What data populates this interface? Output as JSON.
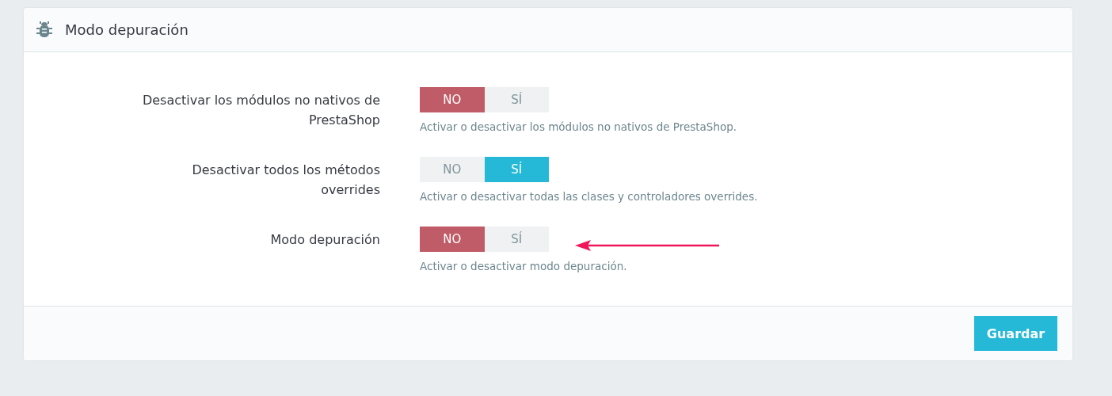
{
  "panel": {
    "title": "Modo depuración"
  },
  "settings": [
    {
      "label": "Desactivar los módulos no nativos de PrestaShop",
      "options": [
        {
          "label": "NO",
          "selected": true
        },
        {
          "label": "SÍ",
          "selected": false
        }
      ],
      "help": "Activar o desactivar los módulos no nativos de PrestaShop."
    },
    {
      "label": "Desactivar todos los métodos overrides",
      "options": [
        {
          "label": "NO",
          "selected": false
        },
        {
          "label": "SÍ",
          "selected": true
        }
      ],
      "help": "Activar o desactivar todas las clases y controladores overrides."
    },
    {
      "label": "Modo depuración",
      "options": [
        {
          "label": "NO",
          "selected": true
        },
        {
          "label": "SÍ",
          "selected": false
        }
      ],
      "help": "Activar o desactivar modo depuración."
    }
  ],
  "footer": {
    "save_button": "Guardar"
  }
}
